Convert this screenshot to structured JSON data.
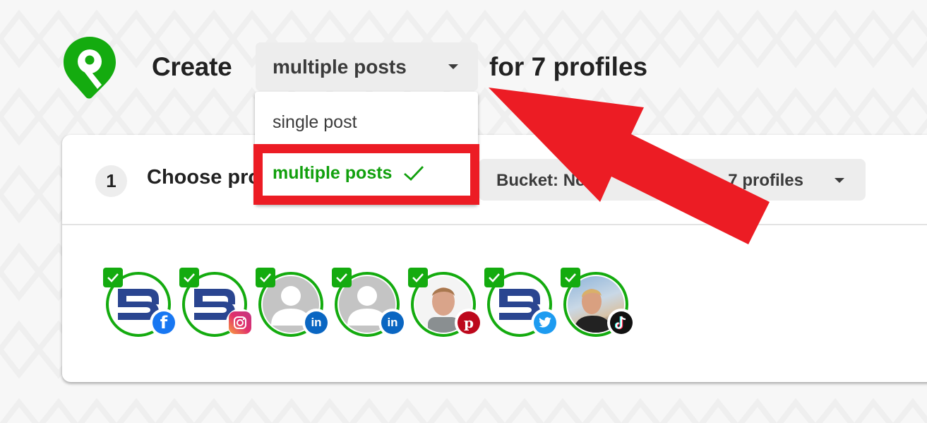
{
  "header": {
    "logo_icon": "pin-logo-icon",
    "create_label": "Create",
    "post_type_select": {
      "selected": "multiple posts",
      "options": [
        {
          "label": "single post",
          "selected": false
        },
        {
          "label": "multiple posts",
          "selected": true
        }
      ]
    },
    "suffix": "for 7 profiles"
  },
  "step": {
    "number": "1",
    "label": "Choose profiles",
    "bucket_label": "Bucket: None",
    "profiles_label": "7 profiles"
  },
  "profiles": [
    {
      "avatar": "brand-logo",
      "network": "facebook",
      "checked": true
    },
    {
      "avatar": "brand-logo",
      "network": "instagram",
      "checked": true
    },
    {
      "avatar": "placeholder-person",
      "network": "linkedin",
      "checked": true
    },
    {
      "avatar": "placeholder-person",
      "network": "linkedin",
      "checked": true
    },
    {
      "avatar": "photo-person",
      "network": "pinterest",
      "checked": true
    },
    {
      "avatar": "brand-logo",
      "network": "twitter",
      "checked": true
    },
    {
      "avatar": "photo-person-outdoor",
      "network": "tiktok",
      "checked": true
    }
  ],
  "colors": {
    "brand_green": "#14ab0f",
    "annotation_red": "#ec1c24",
    "selected_text_green": "#11a00d"
  },
  "annotations": {
    "highlight": "red-box-around-multiple-posts",
    "arrow": "red-arrow-pointing-to-dropdown"
  }
}
